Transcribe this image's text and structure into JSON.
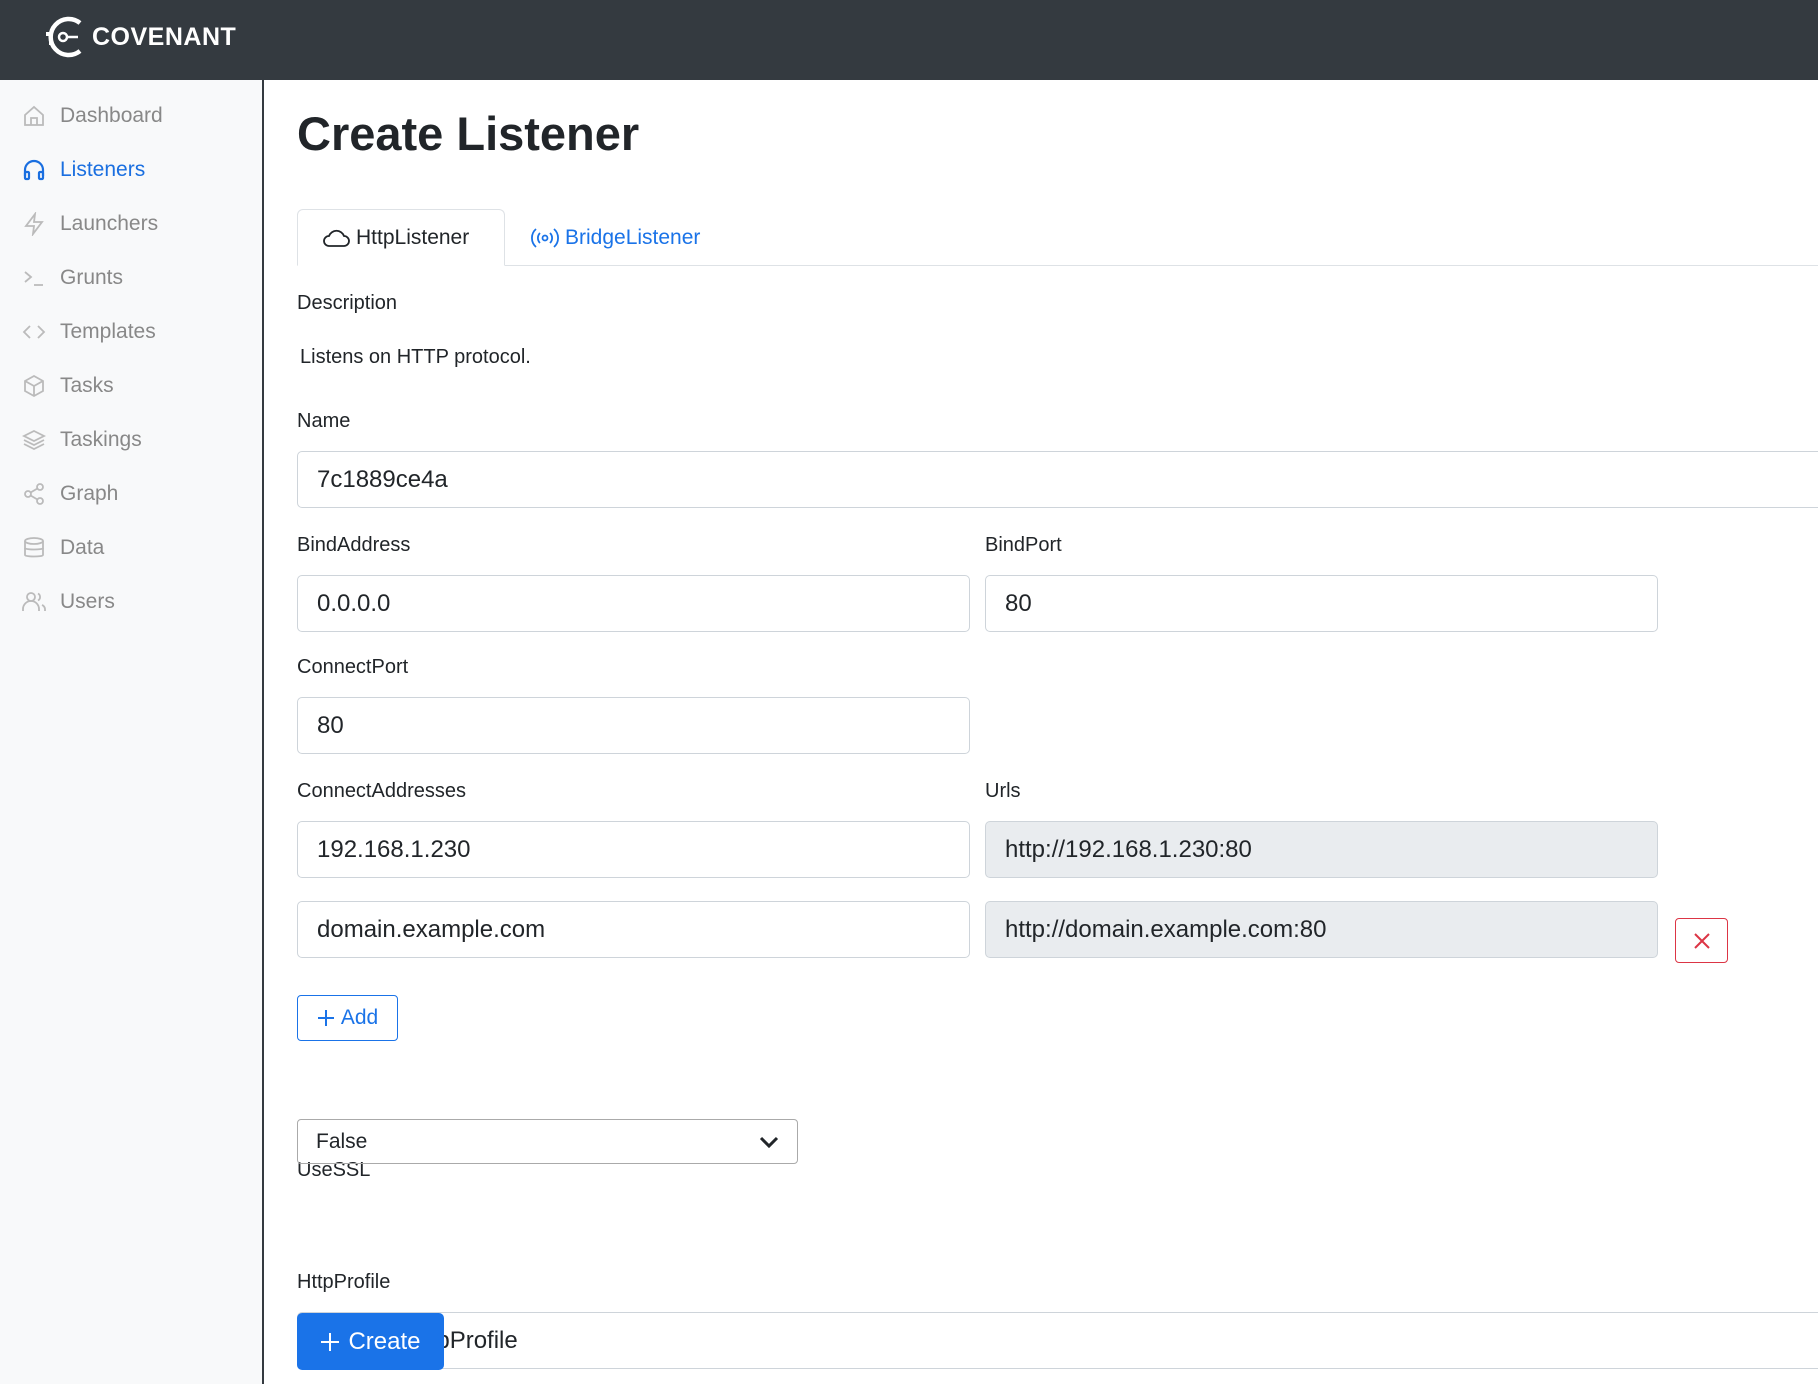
{
  "brand": {
    "name": "COVENANT"
  },
  "sidebar": {
    "items": [
      {
        "label": "Dashboard",
        "icon": "home-icon"
      },
      {
        "label": "Listeners",
        "icon": "headphones-icon",
        "active": true
      },
      {
        "label": "Launchers",
        "icon": "lightning-icon"
      },
      {
        "label": "Grunts",
        "icon": "terminal-icon"
      },
      {
        "label": "Templates",
        "icon": "code-icon"
      },
      {
        "label": "Tasks",
        "icon": "box-icon"
      },
      {
        "label": "Taskings",
        "icon": "layers-icon"
      },
      {
        "label": "Graph",
        "icon": "share-icon"
      },
      {
        "label": "Data",
        "icon": "database-icon"
      },
      {
        "label": "Users",
        "icon": "users-icon"
      }
    ]
  },
  "colors": {
    "accent": "#1a73e8",
    "danger": "#dc3545",
    "topbar": "#343a40"
  },
  "page": {
    "title": "Create Listener",
    "tabs": [
      {
        "label": "HttpListener",
        "icon": "cloud-icon",
        "active": true
      },
      {
        "label": "BridgeListener",
        "icon": "broadcast-icon"
      }
    ],
    "description_label": "Description",
    "description": "Listens on HTTP protocol.",
    "name_label": "Name",
    "name_value": "7c1889ce4a",
    "bind_address_label": "BindAddress",
    "bind_address_value": "0.0.0.0",
    "bind_port_label": "BindPort",
    "bind_port_value": "80",
    "connect_port_label": "ConnectPort",
    "connect_port_value": "80",
    "connect_addresses_label": "ConnectAddresses",
    "urls_label": "Urls",
    "connect_addresses": [
      "192.168.1.230",
      "domain.example.com"
    ],
    "urls": [
      "http://192.168.1.230:80",
      "http://domain.example.com:80"
    ],
    "add_label": "Add",
    "use_ssl_label": "UseSSL",
    "use_ssl_value": "False",
    "http_profile_label": "HttpProfile",
    "http_profile_value": "CustomHttpProfile",
    "create_label": "Create"
  }
}
